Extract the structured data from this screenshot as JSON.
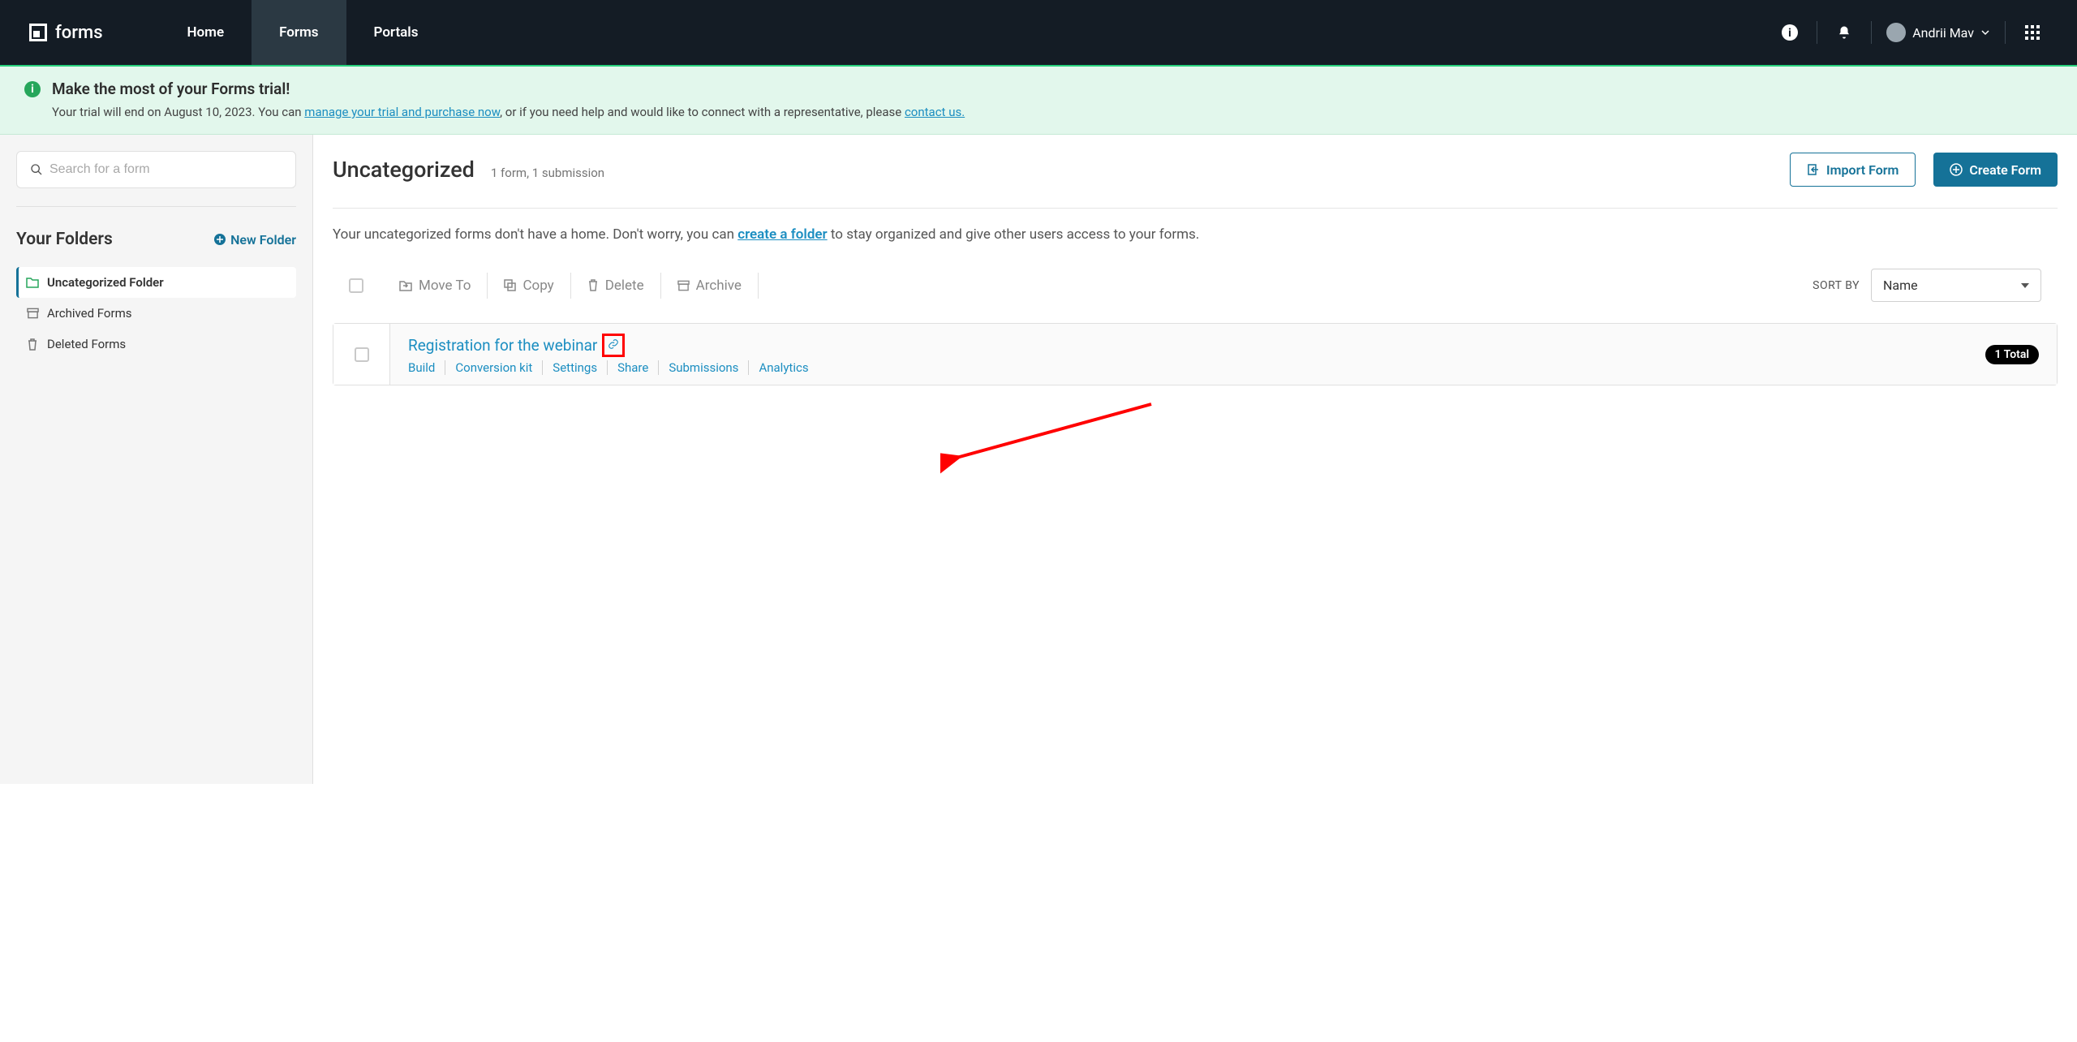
{
  "brand": "forms",
  "nav": {
    "home": "Home",
    "forms": "Forms",
    "portals": "Portals"
  },
  "user": {
    "name": "Andrii Mav"
  },
  "banner": {
    "title": "Make the most of your Forms trial!",
    "text1": "Your trial will end on August 10, 2023. You can ",
    "link1": "manage your trial and purchase now",
    "text2": ", or if you need help and would like to connect with a representative, please ",
    "link2": "contact us."
  },
  "search": {
    "placeholder": "Search for a form"
  },
  "folders": {
    "heading": "Your Folders",
    "new": "New Folder",
    "items": [
      {
        "label": "Uncategorized Folder"
      },
      {
        "label": "Archived Forms"
      },
      {
        "label": "Deleted Forms"
      }
    ]
  },
  "page": {
    "title": "Uncategorized",
    "sub": "1 form, 1 submission",
    "import": "Import Form",
    "create": "Create Form"
  },
  "hint": {
    "t1": "Your uncategorized forms don't have a home. Don't worry, you can ",
    "link": "create a folder",
    "t2": " to stay organized and give other users access to your forms."
  },
  "toolbar": {
    "move": "Move To",
    "copy": "Copy",
    "delete": "Delete",
    "archive": "Archive",
    "sortLabel": "SORT BY",
    "sortValue": "Name"
  },
  "formRow": {
    "title": "Registration for the webinar",
    "links": {
      "build": "Build",
      "kit": "Conversion kit",
      "settings": "Settings",
      "share": "Share",
      "submissions": "Submissions",
      "analytics": "Analytics"
    },
    "total": "1 Total"
  }
}
